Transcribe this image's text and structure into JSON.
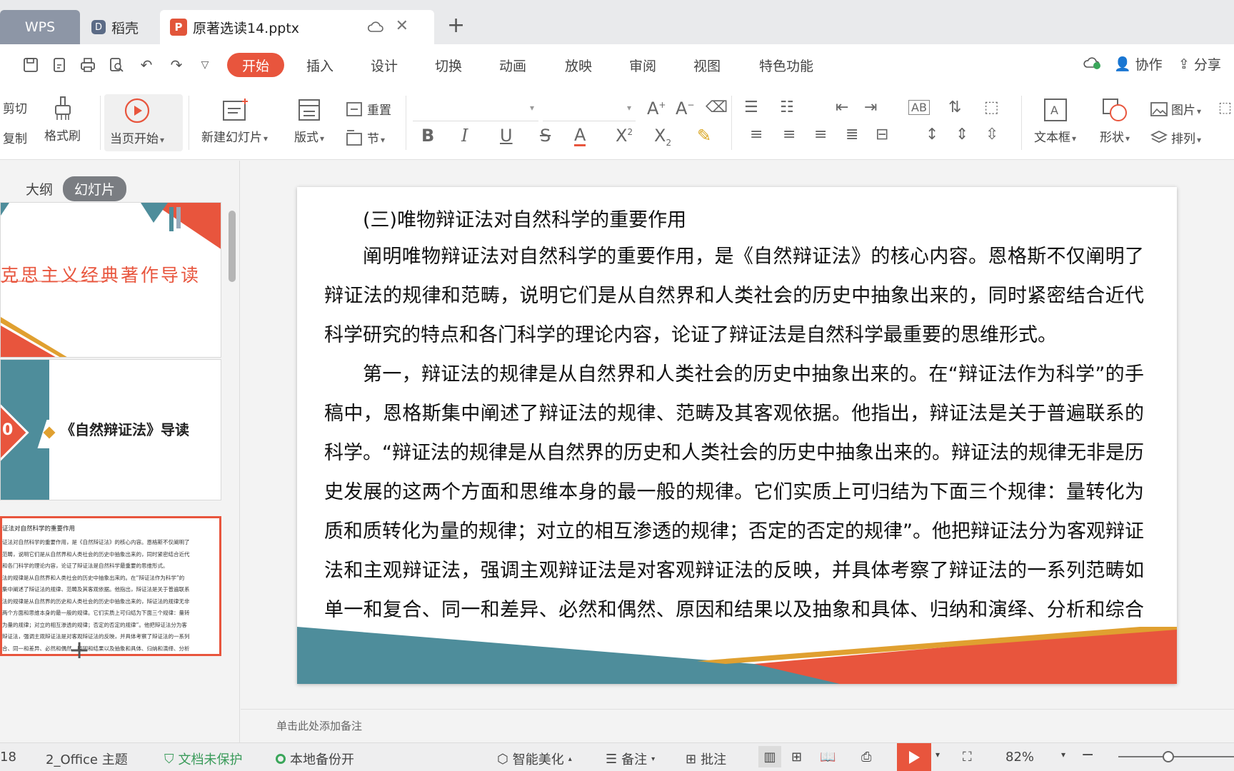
{
  "tabs": {
    "wps": "WPS",
    "daoke": "稻壳",
    "document": "原著选读14.pptx"
  },
  "menu": {
    "items": [
      "开始",
      "插入",
      "设计",
      "切换",
      "动画",
      "放映",
      "审阅",
      "视图",
      "特色功能"
    ],
    "active": "开始",
    "collaborate": "协作",
    "share": "分享"
  },
  "ribbon": {
    "cut": "剪切",
    "copy": "复制",
    "format_painter": "格式刷",
    "play_from_current": "当页开始",
    "new_slide": "新建幻灯片",
    "layout": "版式",
    "reset": "重置",
    "section": "节",
    "text_box": "文本框",
    "shape": "形状",
    "picture": "图片",
    "arrange": "排列"
  },
  "left_panel": {
    "outline": "大纲",
    "slides": "幻灯片",
    "thumb1_title": "克思主义经典著作导读",
    "thumb2_title": "《自然辩证法》导读",
    "thumb2_badge": "0",
    "thumb3_heading": "证法对自然科学的重要作用",
    "thumb3_lines": [
      "证法对自然科学的重要作用，是《自然辩证法》的核心内容。恩格斯不仅阐明了",
      "范畴，说明它们是从自然界和人类社会的历史中抽象出来的，同时紧密结合近代",
      "和各门科学的理论内容，论证了辩证法是自然科学最重要的思维形式。",
      "法的规律是从自然界和人类社会的历史中抽象出来的。在“辩证法作为科学”的",
      "集中阐述了辩证法的规律、范畴及其客观依据。他指出，辩证法是关于普遍联系",
      "法的规律是从自然界的历史和人类社会的历史中抽象出来的，辩证法的规律无非",
      "两个方面和思维本身的最一般的规律。它们实质上可归结为下面三个规律：量转",
      "为量的规律；对立的相互渗透的规律；否定的否定的规律”。他把辩证法分为客",
      "辩证法，强调主观辩证法是对客观辩证法的反映，并具体考察了辩证法的一系列",
      "合、同一和差异、必然和偶然、原因和结果以及抽象和具体、归纳和演绎、分析"
    ]
  },
  "slide": {
    "title": "(三)唯物辩证法对自然科学的重要作用",
    "paragraph1": "阐明唯物辩证法对自然科学的重要作用，是《自然辩证法》的核心内容。恩格斯不仅阐明了辩证法的规律和范畴，说明它们是从自然界和人类社会的历史中抽象出来的，同时紧密结合近代科学研究的特点和各门科学的理论内容，论证了辩证法是自然科学最重要的思维形式。",
    "paragraph2": "第一，辩证法的规律是从自然界和人类社会的历史中抽象出来的。在“辩证法作为科学”的手稿中，恩格斯集中阐述了辩证法的规律、范畴及其客观依据。他指出，辩证法是关于普遍联系的科学。“辩证法的规律是从自然界的历史和人类社会的历史中抽象出来的。辩证法的规律无非是历史发展的这两个方面和思维本身的最一般的规律。它们实质上可归结为下面三个规律：量转化为质和质转化为量的规律；对立的相互渗透的规律；否定的否定的规律”。他把辩证法分为客观辩证法和主观辩证法，强调主观辩证法是对客观辩证法的反映，并具体考察了辩证法的一系列范畴如单一和复合、同一和差异、必然和偶然、原因和结果以及抽象和具体、归纳和演绎、分析和综合等。"
  },
  "notes_placeholder": "单击此处添加备注",
  "status": {
    "slide_count": "18",
    "theme": "2_Office 主题",
    "protection": "文档未保护",
    "backup": "本地备份开",
    "beautify": "智能美化",
    "notes": "备注",
    "comments": "批注",
    "zoom": "82%"
  },
  "colors": {
    "accent": "#e8553d",
    "teal": "#4e8d9b",
    "gold": "#e0a030"
  }
}
